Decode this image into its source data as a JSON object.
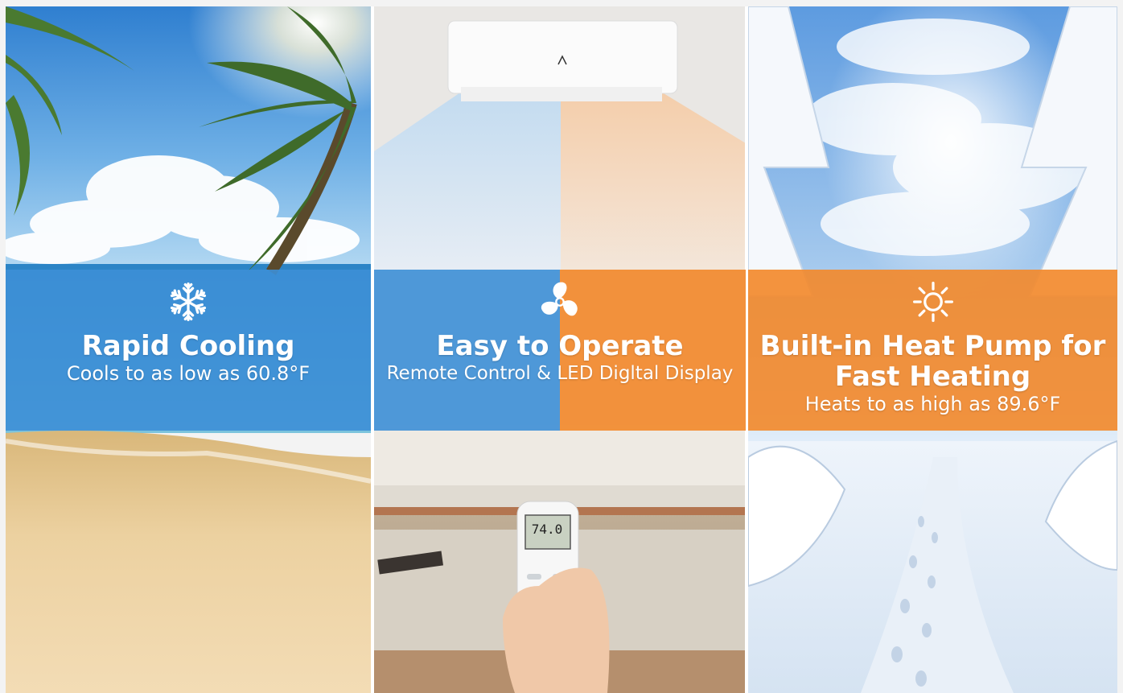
{
  "panels": [
    {
      "id": "cooling",
      "title": "Rapid Cooling",
      "subtitle": "Cools to as low as 60.8°F",
      "icon": "snowflake-icon",
      "band_color": "#3d8fd6"
    },
    {
      "id": "operate",
      "title": "Easy to Operate",
      "subtitle": "Remote Control & LED Digltal Display",
      "icon": "fan-icon",
      "band_colors": [
        "#3d8fd6",
        "#f28a2e"
      ],
      "remote_display": "74.0"
    },
    {
      "id": "heating",
      "title_line1": "Built-in Heat Pump for",
      "title_line2": "Fast Heating",
      "subtitle": "Heats to as high as 89.6°F",
      "icon": "sun-icon",
      "band_color": "#f28a2e"
    }
  ],
  "colors": {
    "cool_blue": "#3d8fd6",
    "warm_orange": "#f28a2e"
  }
}
